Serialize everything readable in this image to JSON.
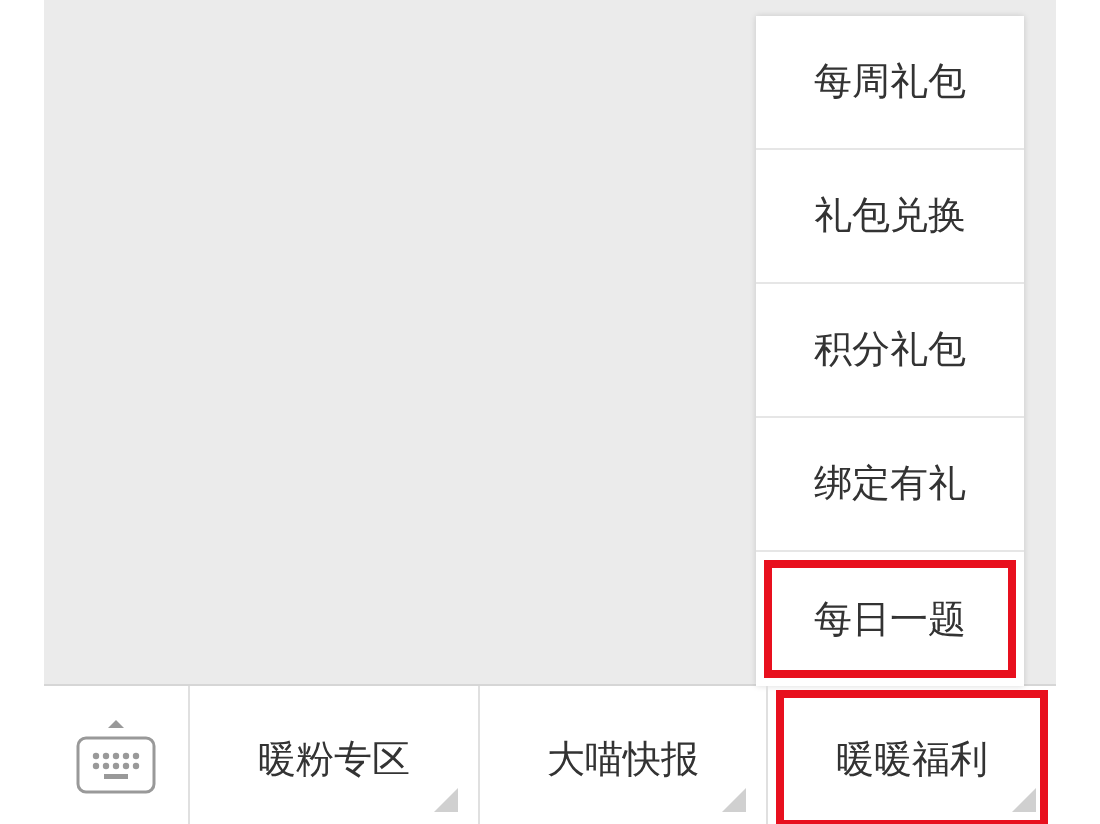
{
  "popup_menu": {
    "items": [
      {
        "label": "每周礼包",
        "highlighted": false
      },
      {
        "label": "礼包兑换",
        "highlighted": false
      },
      {
        "label": "积分礼包",
        "highlighted": false
      },
      {
        "label": "绑定有礼",
        "highlighted": false
      },
      {
        "label": "每日一题",
        "highlighted": true
      }
    ]
  },
  "bottom_menu": {
    "items": [
      {
        "kind": "keyboard"
      },
      {
        "kind": "menu",
        "label": "暖粉专区",
        "highlighted": false
      },
      {
        "kind": "menu",
        "label": "大喵快报",
        "highlighted": false
      },
      {
        "kind": "menu",
        "label": "暖暖福利",
        "highlighted": true
      }
    ]
  }
}
